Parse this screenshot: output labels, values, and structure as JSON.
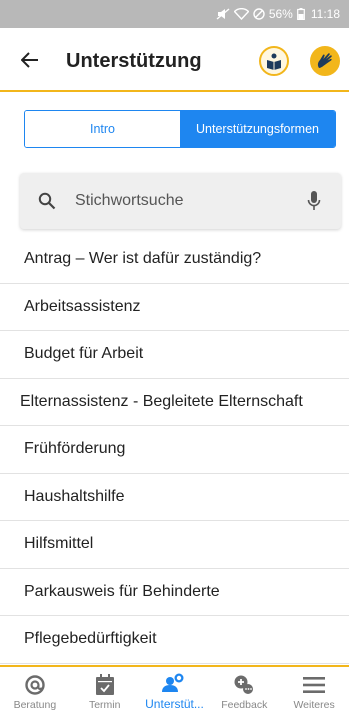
{
  "status_bar": {
    "battery": "56%",
    "time": "11:18"
  },
  "header": {
    "title": "Unterstützung"
  },
  "tabs": [
    {
      "label": "Intro",
      "active": false
    },
    {
      "label": "Unterstützungsformen",
      "active": true
    }
  ],
  "search": {
    "placeholder": "Stichwortsuche",
    "value": ""
  },
  "list": {
    "items": [
      "Antrag – Wer ist dafür zuständig?",
      "Arbeitsassistenz",
      "Budget für Arbeit",
      "Elternassistenz - Begleitete Elternschaft",
      "Frühförderung",
      "Haushaltshilfe",
      "Hilfsmittel",
      "Parkausweis für Behinderte",
      "Pflegebedürftigkeit"
    ]
  },
  "bottom_nav": {
    "items": [
      {
        "label": "Beratung",
        "icon": "at-icon",
        "active": false
      },
      {
        "label": "Termin",
        "icon": "calendar-icon",
        "active": false
      },
      {
        "label": "Unterstüt...",
        "icon": "people-icon",
        "active": true
      },
      {
        "label": "Feedback",
        "icon": "feedback-icon",
        "active": false
      },
      {
        "label": "Weiteres",
        "icon": "menu-icon",
        "active": false
      }
    ]
  },
  "colors": {
    "accent": "#f2b61b",
    "primary": "#1e86f0",
    "status_bar": "#b8b8b8"
  }
}
